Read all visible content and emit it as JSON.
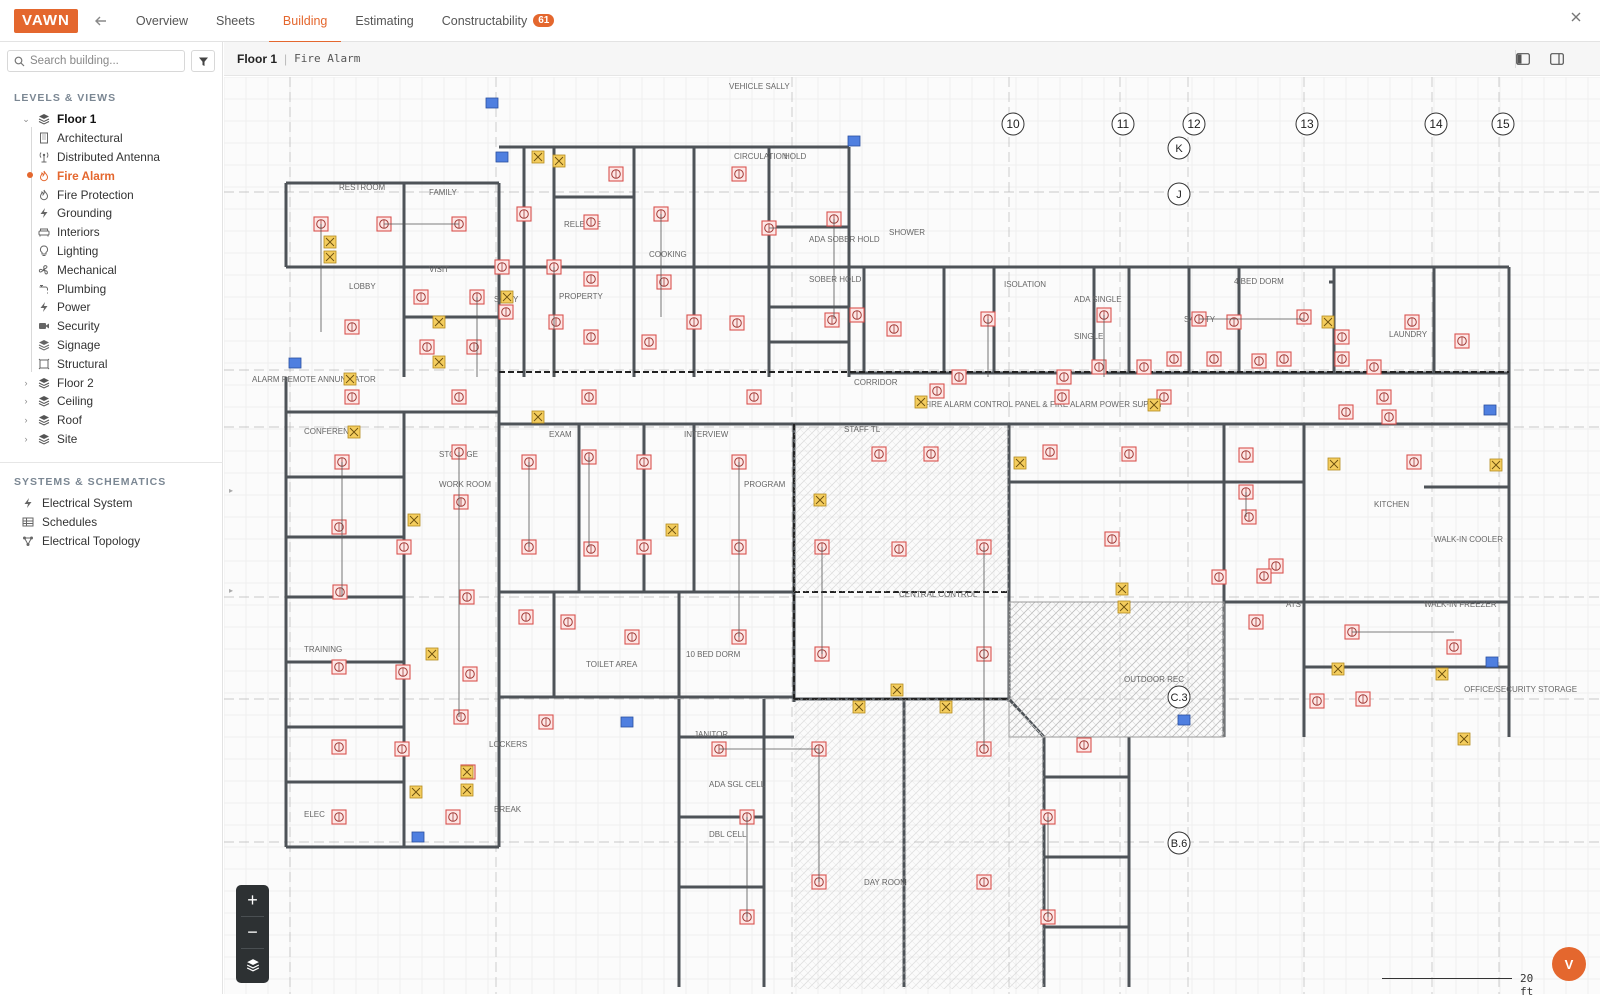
{
  "header": {
    "logo": "VAWN",
    "tabs": [
      {
        "label": "Overview"
      },
      {
        "label": "Sheets"
      },
      {
        "label": "Building"
      },
      {
        "label": "Estimating"
      },
      {
        "label": "Constructability",
        "badge": "61"
      }
    ],
    "active_tab": "Building"
  },
  "sidebar": {
    "search_placeholder": "Search building...",
    "levels_title": "LEVELS & VIEWS",
    "floor1": "Floor 1",
    "floor1_items": [
      {
        "label": "Architectural",
        "icon": "building-icon"
      },
      {
        "label": "Distributed Antenna",
        "icon": "antenna-icon"
      },
      {
        "label": "Fire Alarm",
        "icon": "flame-icon",
        "active": true
      },
      {
        "label": "Fire Protection",
        "icon": "flame-icon"
      },
      {
        "label": "Grounding",
        "icon": "bolt-icon"
      },
      {
        "label": "Interiors",
        "icon": "sofa-icon"
      },
      {
        "label": "Lighting",
        "icon": "bulb-icon"
      },
      {
        "label": "Mechanical",
        "icon": "fan-icon"
      },
      {
        "label": "Plumbing",
        "icon": "faucet-icon"
      },
      {
        "label": "Power",
        "icon": "bolt-icon"
      },
      {
        "label": "Security",
        "icon": "camera-icon"
      },
      {
        "label": "Signage",
        "icon": "layers-icon"
      },
      {
        "label": "Structural",
        "icon": "frame-icon"
      }
    ],
    "other_levels": [
      "Floor 2",
      "Ceiling",
      "Roof",
      "Site"
    ],
    "systems_title": "SYSTEMS & SCHEMATICS",
    "systems": [
      {
        "label": "Electrical System",
        "icon": "bolt-icon"
      },
      {
        "label": "Schedules",
        "icon": "table-icon"
      },
      {
        "label": "Electrical Topology",
        "icon": "topology-icon"
      }
    ]
  },
  "breadcrumb": {
    "floor": "Floor 1",
    "view": "Fire Alarm"
  },
  "plan": {
    "grid_columns": [
      "10",
      "11",
      "12",
      "13",
      "14",
      "15"
    ],
    "grid_rows": [
      "K",
      "J",
      "C.3",
      "B.6"
    ],
    "rooms": [
      "VEHICLE SALLY",
      "CIRCULATION",
      "HOLD",
      "RESTROOM",
      "FAMILY",
      "LOBBY",
      "VISIT",
      "SALLY",
      "PROPERTY",
      "RELEASE",
      "COOKING",
      "ADA SOBER HOLD",
      "SOBER HOLD",
      "SHOWER",
      "ISOLATION",
      "ADA SINGLE",
      "SINGLE",
      "4 BED DORM",
      "SAFETY",
      "LAUNDRY",
      "CORRIDOR",
      "FIRE ALARM CONTROL PANEL & FIRE ALARM POWER SUPPLY",
      "CONFERENCE",
      "STORAGE",
      "WORK ROOM",
      "EXAM",
      "INTERVIEW",
      "PROGRAM",
      "STAFF TL",
      "KITCHEN",
      "WALK-IN COOLER",
      "WALK-IN FREEZER",
      "CENTRAL CONTROL",
      "TOILET AREA",
      "10 BED DORM",
      "OUTDOOR REC",
      "JANITOR",
      "LOCKERS",
      "BREAK",
      "ELEC",
      "ADA SGL CELL",
      "DBL CELL",
      "DAY ROOM",
      "OFFICE/SECURITY STORAGE",
      "ALARM REMOTE ANNUNCIATOR",
      "TRAINING",
      "ATS"
    ]
  },
  "scale_label": "20 ft",
  "user_initial": "V",
  "colors": {
    "accent": "#e4672e",
    "device": "#d9534f",
    "strobe": "#e8b43a",
    "panel": "#3b6fd1"
  }
}
